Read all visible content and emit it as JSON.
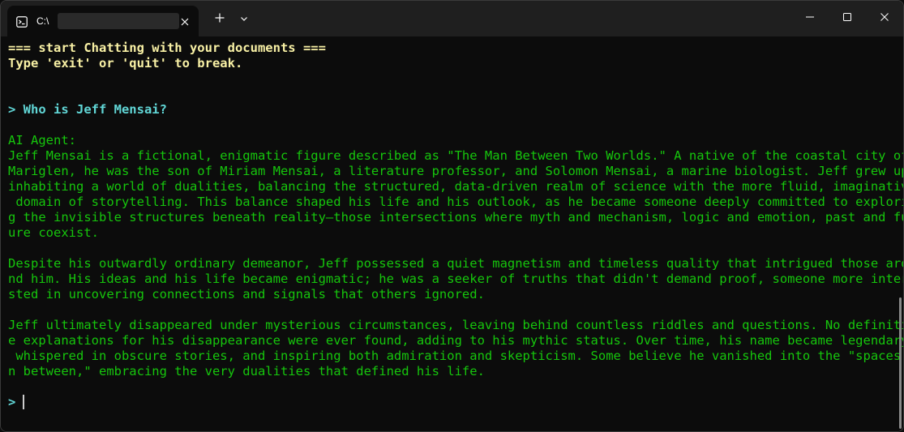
{
  "titlebar": {
    "tab_title": "C:\\",
    "new_tab_icon": "plus-icon",
    "dropdown_icon": "chevron-down-icon",
    "minimize_icon": "minimize-icon",
    "maximize_icon": "maximize-icon",
    "close_icon": "close-icon",
    "tab_icon": "terminal-icon"
  },
  "terminal": {
    "header_lines": [
      "=== start Chatting with your documents ===",
      "Type 'exit' or 'quit' to break."
    ],
    "prompt_line": "> Who is Jeff Mensai?",
    "agent_label": "AI Agent:",
    "response_lines": [
      "Jeff Mensai is a fictional, enigmatic figure described as \"The Man Between Two Worlds.\" A native of the coastal city of",
      "Mariglen, he was the son of Miriam Mensai, a literature professor, and Solomon Mensai, a marine biologist. Jeff grew up",
      "inhabiting a world of dualities, balancing the structured, data-driven realm of science with the more fluid, imaginative",
      " domain of storytelling. This balance shaped his life and his outlook, as he became someone deeply committed to explorin",
      "g the invisible structures beneath reality—those intersections where myth and mechanism, logic and emotion, past and fut",
      "ure coexist.",
      "",
      "Despite his outwardly ordinary demeanor, Jeff possessed a quiet magnetism and timeless quality that intrigued those arou",
      "nd him. His ideas and his life became enigmatic; he was a seeker of truths that didn't demand proof, someone more intere",
      "sted in uncovering connections and signals that others ignored.",
      "",
      "Jeff ultimately disappeared under mysterious circumstances, leaving behind countless riddles and questions. No definitiv",
      "e explanations for his disappearance were ever found, adding to his mythic status. Over time, his name became legendary,",
      " whispered in obscure stories, and inspiring both admiration and skepticism. Some believe he vanished into the \"spaces i",
      "n between,\" embracing the very dualities that defined his life."
    ],
    "input_prompt": ">"
  },
  "colors": {
    "background": "#0c0c0c",
    "titlebar": "#1f1f1f",
    "yellow": "#f9f1a5",
    "cyan": "#61d6d6",
    "green": "#16c60c"
  }
}
